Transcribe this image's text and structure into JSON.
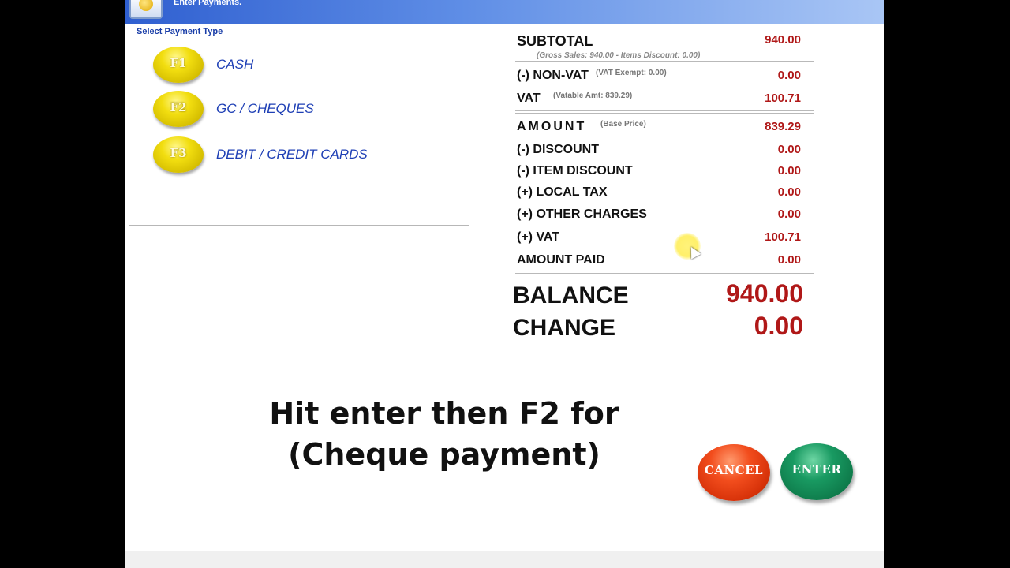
{
  "window": {
    "title": "Enter Payments."
  },
  "payment_type": {
    "legend": "Select Payment Type",
    "options": [
      {
        "key": "F1",
        "label": "CASH"
      },
      {
        "key": "F2",
        "label": "GC / CHEQUES"
      },
      {
        "key": "F3",
        "label": "DEBIT / CREDIT CARDS"
      }
    ]
  },
  "summary": {
    "subtotal": {
      "label": "SUBTOTAL",
      "value": "940.00",
      "detail": "(Gross Sales: 940.00 - Items Discount: 0.00)"
    },
    "non_vat": {
      "label": "(-) NON-VAT",
      "note": "(VAT Exempt: 0.00)",
      "value": "0.00"
    },
    "vat": {
      "label": "VAT",
      "note": "(Vatable Amt: 839.29)",
      "value": "100.71"
    },
    "amount": {
      "label": "AMOUNT",
      "note": "(Base Price)",
      "value": "839.29"
    },
    "discount": {
      "label": "(-) DISCOUNT",
      "value": "0.00"
    },
    "item_discount": {
      "label": "(-) ITEM DISCOUNT",
      "value": "0.00"
    },
    "local_tax": {
      "label": "(+) LOCAL TAX",
      "value": "0.00"
    },
    "other_charges": {
      "label": "(+) OTHER CHARGES",
      "value": "0.00"
    },
    "plus_vat": {
      "label": "(+) VAT",
      "value": "100.71"
    },
    "amount_paid": {
      "label": "AMOUNT PAID",
      "value": "0.00"
    },
    "balance": {
      "label": "BALANCE",
      "value": "940.00"
    },
    "change": {
      "label": "CHANGE",
      "value": "0.00"
    }
  },
  "caption": {
    "line1": "Hit enter then F2 for",
    "line2": "(Cheque payment)"
  },
  "buttons": {
    "cancel": "CANCEL",
    "enter": "ENTER"
  },
  "colors": {
    "value_red": "#b01818",
    "label_blue": "#1e3fb5",
    "fkey_yellow": "#f2de10",
    "cancel_red": "#e8431a",
    "enter_green": "#199a62",
    "titlebar_blue": "#2f5fd0"
  },
  "icons": {
    "app": "app-logo-icon",
    "cursor": "mouse-pointer-icon"
  }
}
